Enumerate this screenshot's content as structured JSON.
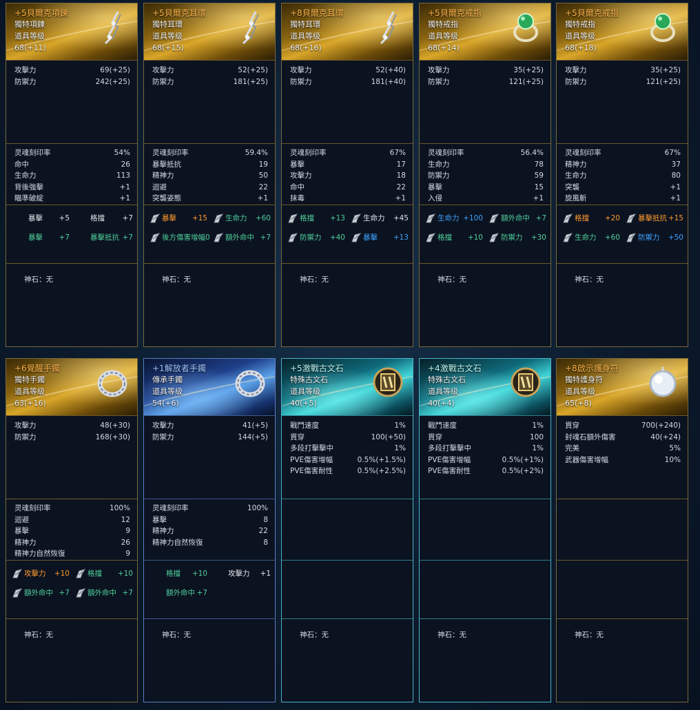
{
  "label_stone": "神石：无",
  "items": [
    {
      "theme": "gold",
      "name": "+5貝爾克項鍊",
      "type": "獨特項鍊",
      "level_label": "道具等级",
      "level": "68(+11)",
      "icon": "necklace-icon",
      "base": [
        [
          "攻擊力",
          "69(+25)"
        ],
        [
          "防禦力",
          "242(+25)"
        ]
      ],
      "stats": [
        [
          "灵魂刻印率",
          "54%"
        ],
        [
          "命中",
          "26"
        ],
        [
          "生命力",
          "113"
        ],
        [
          "背後強擊",
          "+1"
        ],
        [
          "瞄準破綻",
          "+1"
        ]
      ],
      "options": [
        {
          "label": "暴擊",
          "value": "+5",
          "color": "white",
          "icon": false
        },
        {
          "label": "格擋",
          "value": "+7",
          "color": "white",
          "icon": false
        },
        {
          "label": "暴擊",
          "value": "+7",
          "color": "green",
          "icon": false
        },
        {
          "label": "暴擊抵抗",
          "value": "+7",
          "color": "green",
          "icon": false
        }
      ]
    },
    {
      "theme": "gold",
      "name": "+5貝爾克耳環",
      "type": "獨特耳環",
      "level_label": "道具等级",
      "level": "68(+15)",
      "icon": "earring-icon",
      "base": [
        [
          "攻擊力",
          "52(+25)"
        ],
        [
          "防禦力",
          "181(+25)"
        ]
      ],
      "stats": [
        [
          "灵魂刻印率",
          "59.4%"
        ],
        [
          "暴擊抵抗",
          "19"
        ],
        [
          "精神力",
          "50"
        ],
        [
          "迴避",
          "22"
        ],
        [
          "突襲姿態",
          "+1"
        ]
      ],
      "options": [
        {
          "label": "暴擊",
          "value": "+15",
          "color": "orange",
          "icon": true
        },
        {
          "label": "生命力",
          "value": "+60",
          "color": "green",
          "icon": true
        },
        {
          "label": "後方傷害增幅0",
          "value": "",
          "color": "green",
          "icon": true
        },
        {
          "label": "額外命中",
          "value": "+7",
          "color": "green",
          "icon": true
        }
      ]
    },
    {
      "theme": "gold",
      "name": "+8貝爾克耳環",
      "type": "獨特耳環",
      "level_label": "道具等级",
      "level": "68(+16)",
      "icon": "earring-icon",
      "base": [
        [
          "攻擊力",
          "52(+40)"
        ],
        [
          "防禦力",
          "181(+40)"
        ]
      ],
      "stats": [
        [
          "灵魂刻印率",
          "67%"
        ],
        [
          "暴擊",
          "17"
        ],
        [
          "攻擊力",
          "18"
        ],
        [
          "命中",
          "22"
        ],
        [
          "抹毒",
          "+1"
        ]
      ],
      "options": [
        {
          "label": "格擋",
          "value": "+13",
          "color": "green",
          "icon": true
        },
        {
          "label": "生命力",
          "value": "+45",
          "color": "white",
          "icon": true
        },
        {
          "label": "防禦力",
          "value": "+40",
          "color": "green",
          "icon": true
        },
        {
          "label": "暴擊",
          "value": "+13",
          "color": "blue",
          "icon": true
        }
      ]
    },
    {
      "theme": "gold",
      "name": "+5貝爾克戒指",
      "type": "獨特戒指",
      "level_label": "道具等级",
      "level": "68(+14)",
      "icon": "ring-icon",
      "base": [
        [
          "攻擊力",
          "35(+25)"
        ],
        [
          "防禦力",
          "121(+25)"
        ]
      ],
      "stats": [
        [
          "灵魂刻印率",
          "56.4%"
        ],
        [
          "生命力",
          "78"
        ],
        [
          "防禦力",
          "59"
        ],
        [
          "暴擊",
          "15"
        ],
        [
          "入侵",
          "+1"
        ]
      ],
      "options": [
        {
          "label": "生命力",
          "value": "+100",
          "color": "blue",
          "icon": true
        },
        {
          "label": "額外命中",
          "value": "+7",
          "color": "green",
          "icon": true
        },
        {
          "label": "格擋",
          "value": "+10",
          "color": "green",
          "icon": true
        },
        {
          "label": "防禦力",
          "value": "+30",
          "color": "green",
          "icon": true
        }
      ]
    },
    {
      "theme": "gold",
      "name": "+5貝爾克戒指",
      "type": "獨特戒指",
      "level_label": "道具等级",
      "level": "68(+18)",
      "icon": "ring-icon",
      "base": [
        [
          "攻擊力",
          "35(+25)"
        ],
        [
          "防禦力",
          "121(+25)"
        ]
      ],
      "stats": [
        [
          "灵魂刻印率",
          "67%"
        ],
        [
          "精神力",
          "37"
        ],
        [
          "生命力",
          "80"
        ],
        [
          "突襲",
          "+1"
        ],
        [
          "旋風斬",
          "+1"
        ]
      ],
      "options": [
        {
          "label": "格擋",
          "value": "+20",
          "color": "orange",
          "icon": true
        },
        {
          "label": "暴擊抵抗",
          "value": "+15",
          "color": "orange",
          "icon": true
        },
        {
          "label": "生命力",
          "value": "+60",
          "color": "green",
          "icon": true
        },
        {
          "label": "防禦力",
          "value": "+50",
          "color": "blue",
          "icon": true
        }
      ]
    },
    {
      "theme": "gold",
      "name": "+6覺醒手鐲",
      "type": "獨特手鐲",
      "level_label": "道具等级",
      "level": "63(+16)",
      "icon": "bracelet-icon",
      "base": [
        [
          "攻擊力",
          "48(+30)"
        ],
        [
          "防禦力",
          "168(+30)"
        ]
      ],
      "stats": [
        [
          "灵魂刻印率",
          "100%"
        ],
        [
          "迴避",
          "12"
        ],
        [
          "暴擊",
          "9"
        ],
        [
          "精神力",
          "26"
        ],
        [
          "精神力自然恢復",
          "9"
        ]
      ],
      "options": [
        {
          "label": "攻擊力",
          "value": "+10",
          "color": "orange",
          "icon": true
        },
        {
          "label": "格擋",
          "value": "+10",
          "color": "green",
          "icon": true
        },
        {
          "label": "額外命中",
          "value": "+7",
          "color": "green",
          "icon": true
        },
        {
          "label": "額外命中",
          "value": "+7",
          "color": "green",
          "icon": true
        }
      ]
    },
    {
      "theme": "blue",
      "name": "+1解放者手鐲",
      "type": "傳承手鐲",
      "level_label": "道具等级",
      "level": "54(+6)",
      "icon": "bracelet-icon",
      "base": [
        [
          "攻擊力",
          "41(+5)"
        ],
        [
          "防禦力",
          "144(+5)"
        ]
      ],
      "stats": [
        [
          "灵魂刻印率",
          "100%"
        ],
        [
          "暴擊",
          "8"
        ],
        [
          "精神力",
          "22"
        ],
        [
          "精神力自然恢復",
          "8"
        ]
      ],
      "options": [
        {
          "label": "格擋",
          "value": "+10",
          "color": "green",
          "icon": false
        },
        {
          "label": "攻擊力",
          "value": "+1",
          "color": "white",
          "icon": false
        },
        {
          "label": "額外命中",
          "value": "+7",
          "color": "green",
          "icon": false
        }
      ]
    },
    {
      "theme": "teal",
      "name": "+5激戰古文石",
      "type": "特殊古文石",
      "level_label": "道具等级",
      "level": "40(+5)",
      "icon": "rune-stone-icon",
      "base": [
        [
          "戰鬥速度",
          "1%"
        ],
        [
          "貫穿",
          "100(+50)"
        ],
        [
          "多段打擊擊中",
          "1%"
        ],
        [
          "PVE傷害增幅",
          "0.5%(+1.5%)"
        ],
        [
          "PVE傷害耐性",
          "0.5%(+2.5%)"
        ]
      ],
      "stats": [],
      "options": []
    },
    {
      "theme": "teal",
      "name": "+4激戰古文石",
      "type": "特殊古文石",
      "level_label": "道具等级",
      "level": "40(+4)",
      "icon": "rune-stone-icon",
      "base": [
        [
          "戰鬥速度",
          "1%"
        ],
        [
          "貫穿",
          "100"
        ],
        [
          "多段打擊擊中",
          "1%"
        ],
        [
          "PVE傷害增幅",
          "0.5%(+1%)"
        ],
        [
          "PVE傷害耐性",
          "0.5%(+2%)"
        ]
      ],
      "stats": [],
      "options": []
    },
    {
      "theme": "gold",
      "name": "+8啟示護身符",
      "type": "獨特護身符",
      "level_label": "道具等级",
      "level": "65(+8)",
      "icon": "amulet-icon",
      "base": [
        [
          "貫穿",
          "700(+240)"
        ],
        [
          "封魂石額外傷害",
          "40(+24)"
        ],
        [
          "完美",
          "5%"
        ],
        [
          "武器傷害增幅",
          "10%"
        ]
      ],
      "stats": [],
      "options": []
    }
  ]
}
